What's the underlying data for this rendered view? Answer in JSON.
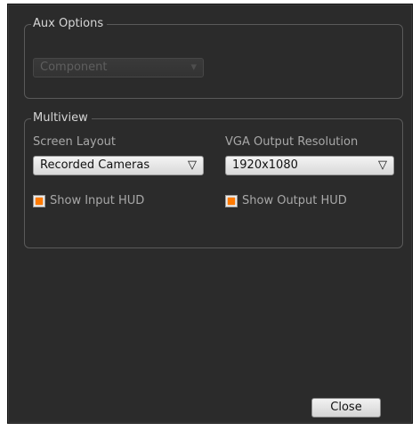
{
  "aux_options": {
    "title": "Aux Options",
    "output_select": {
      "value": "Component"
    }
  },
  "multiview": {
    "title": "Multiview",
    "screen_layout": {
      "label": "Screen Layout",
      "value": "Recorded Cameras"
    },
    "vga_resolution": {
      "label": "VGA Output Resolution",
      "value": "1920x1080"
    },
    "show_input_hud": {
      "label": "Show Input HUD",
      "checked": true
    },
    "show_output_hud": {
      "label": "Show Output HUD",
      "checked": true
    }
  },
  "footer": {
    "close_label": "Close"
  },
  "icons": {
    "dropdown": "triangle-down-icon",
    "check_fill": "#ff7a00"
  }
}
